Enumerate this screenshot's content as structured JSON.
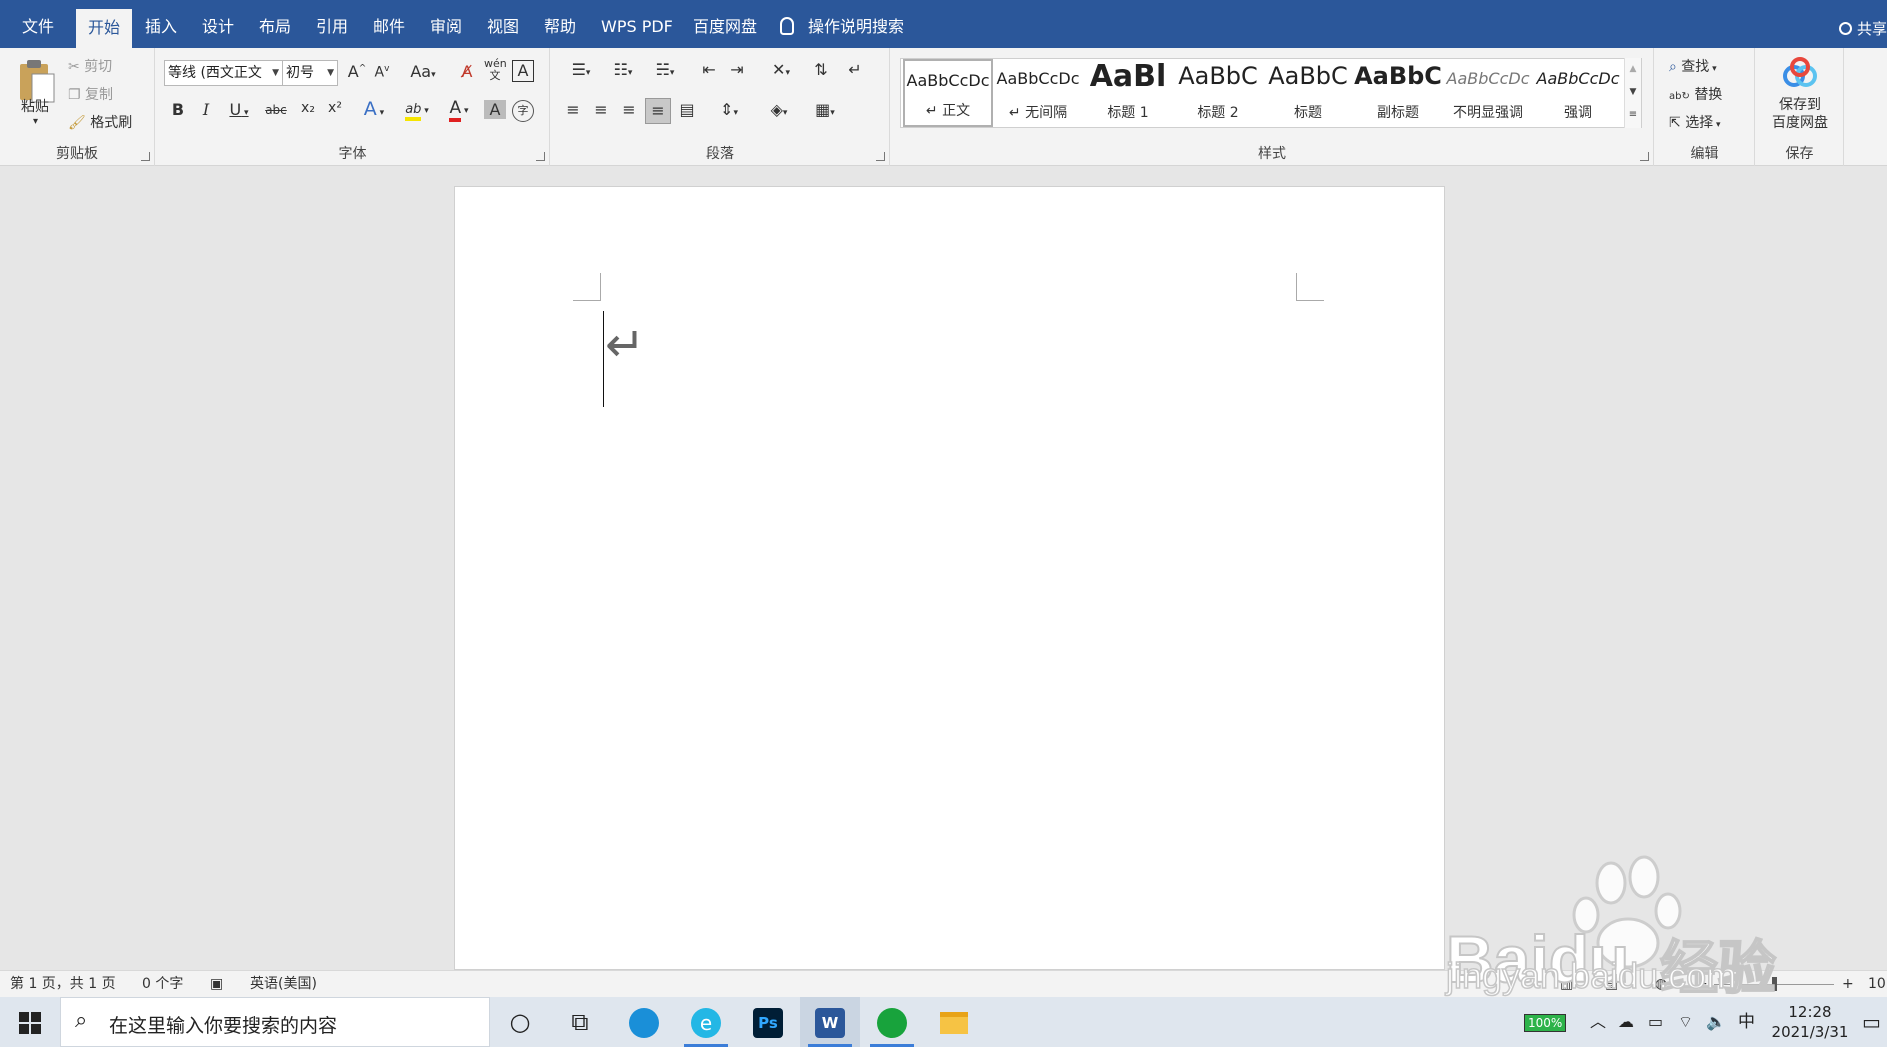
{
  "menu": {
    "file": "文件",
    "tabs": [
      "开始",
      "插入",
      "设计",
      "布局",
      "引用",
      "邮件",
      "审阅",
      "视图",
      "帮助",
      "WPS PDF",
      "百度网盘"
    ],
    "tell_me": "操作说明搜索",
    "share": "共享"
  },
  "clipboard": {
    "paste": "粘贴",
    "cut": "剪切",
    "copy": "复制",
    "format_painter": "格式刷",
    "label": "剪贴板"
  },
  "font": {
    "name_value": "等线 (西文正文",
    "size_value": "初号",
    "label": "字体",
    "grow": "A",
    "shrink": "A",
    "case": "Aa",
    "phonetic": "wén",
    "border_char": "A",
    "bold": "B",
    "italic": "I",
    "underline": "U",
    "strike": "abc",
    "sub": "x₂",
    "sup": "x²",
    "text_effect": "A",
    "highlight": "ab",
    "font_color": "A",
    "shading": "A",
    "enclose": "字"
  },
  "paragraph": {
    "label": "段落"
  },
  "styles": {
    "label": "样式",
    "items": [
      {
        "sample": "AaBbCcDc",
        "name": "↵ 正文"
      },
      {
        "sample": "AaBbCcDc",
        "name": "↵ 无间隔"
      },
      {
        "sample": "AaBl",
        "name": "标题 1"
      },
      {
        "sample": "AaBbC",
        "name": "标题 2"
      },
      {
        "sample": "AaBbC",
        "name": "标题"
      },
      {
        "sample": "AaBbC",
        "name": "副标题"
      },
      {
        "sample": "AaBbCcDc",
        "name": "不明显强调"
      },
      {
        "sample": "AaBbCcDc",
        "name": "强调"
      }
    ]
  },
  "editing": {
    "find": "查找",
    "replace": "替换",
    "select": "选择",
    "label": "编辑"
  },
  "save": {
    "button_line1": "保存到",
    "button_line2": "百度网盘",
    "label": "保存"
  },
  "document": {
    "paragraph_mark": "↵"
  },
  "status": {
    "page": "第 1 页，共 1 页",
    "words": "0 个字",
    "language": "英语(美国)",
    "zoom": "10"
  },
  "taskbar": {
    "search_placeholder": "在这里输入你要搜索的内容",
    "battery": "100%",
    "ime": "中",
    "time": "12:28",
    "date": "2021/3/31"
  },
  "watermark": {
    "brand": "Baidu",
    "brand_cn": "经验",
    "url": "jingyan.baidu.com"
  }
}
